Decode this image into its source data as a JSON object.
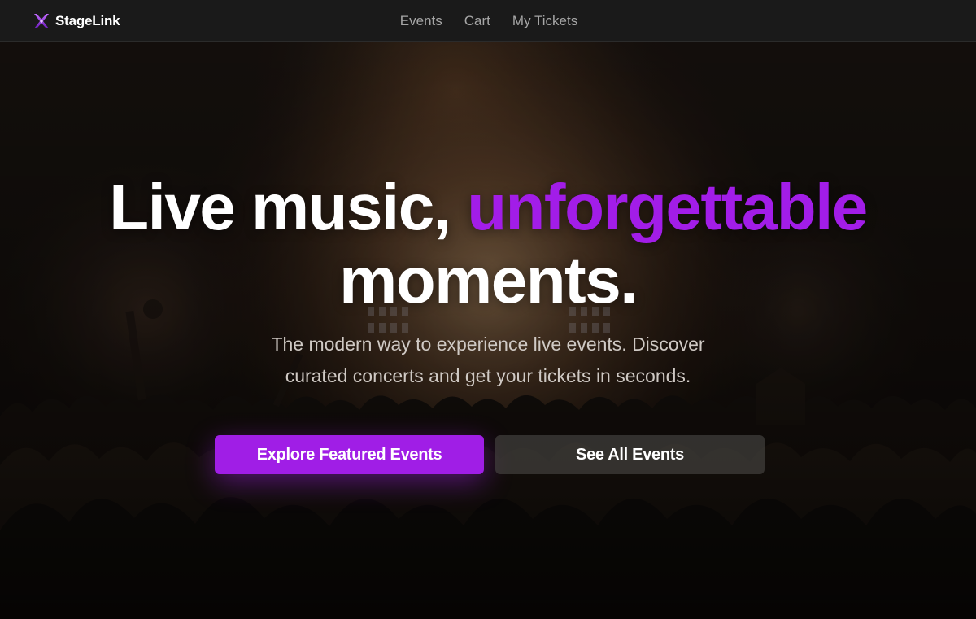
{
  "brand": {
    "name": "StageLink",
    "icon": "stagelink-logo-icon",
    "color": "#8b2be2"
  },
  "nav": {
    "links": [
      {
        "label": "Events"
      },
      {
        "label": "Cart"
      },
      {
        "label": "My Tickets"
      }
    ]
  },
  "hero": {
    "background": "concert-crowd-stage-lights-image",
    "headline_part1": "Live music, ",
    "headline_accent": "unforgettable",
    "headline_part2": "moments.",
    "subheadline": "The modern way to experience live events. Discover curated concerts and get your tickets in seconds.",
    "primary_button": "Explore Featured Events",
    "secondary_button": "See All Events"
  },
  "colors": {
    "accent": "#a21de8",
    "nav_background": "#1a1a1a",
    "button_primary": "#a01ee6"
  }
}
